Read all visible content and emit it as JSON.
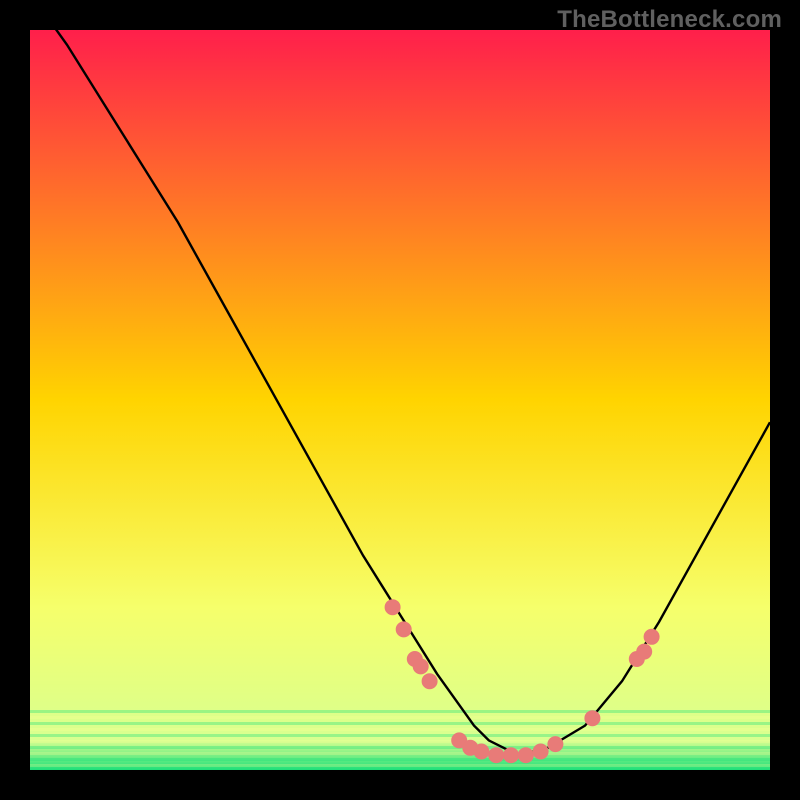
{
  "watermark": "TheBottleneck.com",
  "colors": {
    "bg": "#000000",
    "grad_top": "#ff1f4b",
    "grad_mid": "#ffd400",
    "grad_low": "#f6ff6b",
    "grad_green": "#1ee07a",
    "curve": "#000000",
    "point_fill": "#e87b78",
    "point_stroke": "#e87b78"
  },
  "chart_data": {
    "type": "line",
    "title": "",
    "xlabel": "",
    "ylabel": "",
    "xlim": [
      0,
      100
    ],
    "ylim": [
      0,
      100
    ],
    "curve": {
      "x": [
        0,
        5,
        10,
        15,
        20,
        25,
        30,
        35,
        40,
        45,
        50,
        55,
        60,
        62,
        64,
        66,
        70,
        75,
        80,
        85,
        90,
        95,
        100
      ],
      "y": [
        105,
        98,
        90,
        82,
        74,
        65,
        56,
        47,
        38,
        29,
        21,
        13,
        6,
        4,
        3,
        2,
        3,
        6,
        12,
        20,
        29,
        38,
        47
      ]
    },
    "points": [
      {
        "x": 49.0,
        "y": 22
      },
      {
        "x": 50.5,
        "y": 19
      },
      {
        "x": 52.0,
        "y": 15
      },
      {
        "x": 52.8,
        "y": 14
      },
      {
        "x": 54.0,
        "y": 12
      },
      {
        "x": 58.0,
        "y": 4
      },
      {
        "x": 59.5,
        "y": 3
      },
      {
        "x": 61.0,
        "y": 2.5
      },
      {
        "x": 63.0,
        "y": 2
      },
      {
        "x": 65.0,
        "y": 2
      },
      {
        "x": 67.0,
        "y": 2
      },
      {
        "x": 69.0,
        "y": 2.5
      },
      {
        "x": 71.0,
        "y": 3.5
      },
      {
        "x": 76.0,
        "y": 7
      },
      {
        "x": 82.0,
        "y": 15
      },
      {
        "x": 83.0,
        "y": 16
      },
      {
        "x": 84.0,
        "y": 18
      }
    ]
  }
}
